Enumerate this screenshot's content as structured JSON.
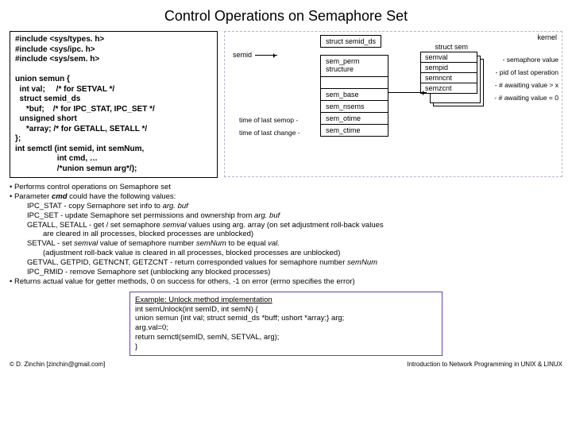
{
  "title": "Control Operations on Semaphore Set",
  "code_left": "#include <sys/types. h>\n#include <sys/ipc. h>\n#include <sys/sem. h>\n\nunion semun {\n  int val;     /* for SETVAL */\n  struct semid_ds\n     *buf;    /* for IPC_STAT, IPC_SET */\n  unsigned short\n     *array; /* for GETALL, SETALL */\n};\nint semctl (int semid, int semNum,\n                   int cmd, …\n                   /*union semun arg*/);",
  "kernel_label": "kernel",
  "semid_label": "semid",
  "ds_label": "struct semid_ds",
  "fields": {
    "perm": "sem_perm\nstructure",
    "base": "sem_base",
    "nsems": "sem_nsems",
    "otime": "sem_otime",
    "ctime": "sem_ctime"
  },
  "time_labels": {
    "op": "time of last semop  -",
    "chg": "time of last change -"
  },
  "sem_header": "struct sem",
  "sem_fields": {
    "val": "semval",
    "pid": "sempid",
    "ncnt": "semncnt",
    "zcnt": "semzcnt"
  },
  "sem_notes": {
    "val": "- semaphore value",
    "pid": "- pid of last operation",
    "ncnt": "- # awaiting value > x",
    "zcnt": "- # awaiting value = 0"
  },
  "bullets": {
    "l1": "• Performs control operations on Semaphore set",
    "l2a": "• Parameter ",
    "l2b": "cmd",
    "l2c": " could have the following values:",
    "l3a": "IPC_STAT  - copy Semaphore set info to ",
    "l3b": "arg. buf",
    "l4a": "IPC_SET    - update Semaphore set permissions and ownership from ",
    "l4b": "arg. buf",
    "l5a": "GETALL, SETALL  - get / set semaphore ",
    "l5b": "semval",
    "l5c": " values using arg. array (on set adjustment roll-back values",
    "l5d": "are cleared in all processes, blocked processes are unblocked)",
    "l6a": "SETVAL      - set ",
    "l6b": "semval",
    "l6c": " value of semaphore number ",
    "l6d": "semNum",
    "l6e": " to be equal ",
    "l6f": "val.",
    "l6g": "(adjustment roll-back value is cleared in all processes, blocked processes are unblocked)",
    "l7a": "GETVAL, GETPID, GETNCNT, GETZCNT      - return corresponded values for semaphore number ",
    "l7b": "semNum",
    "l8": "IPC_RMID  - remove Semaphore set (unblocking any blocked processes)",
    "l9": "• Returns actual value for getter methods, 0 on success for others, -1 on error (errno specifies the error)"
  },
  "example": {
    "title": "Example: Unlock method implementation",
    "l1": "int semUnlock(int semID, int semN) {",
    "l2": "   union semun {int val; struct semid_ds *buff; ushort *array;} arg;",
    "l3": "   arg.val=0;",
    "l4": "   return semctl(semID, semN, SETVAL, arg);",
    "l5": "}"
  },
  "footer": {
    "left": "© D. Zinchin [zinchin@gmail.com]",
    "right": "Introduction to Network Programming in UNIX & LINUX"
  }
}
